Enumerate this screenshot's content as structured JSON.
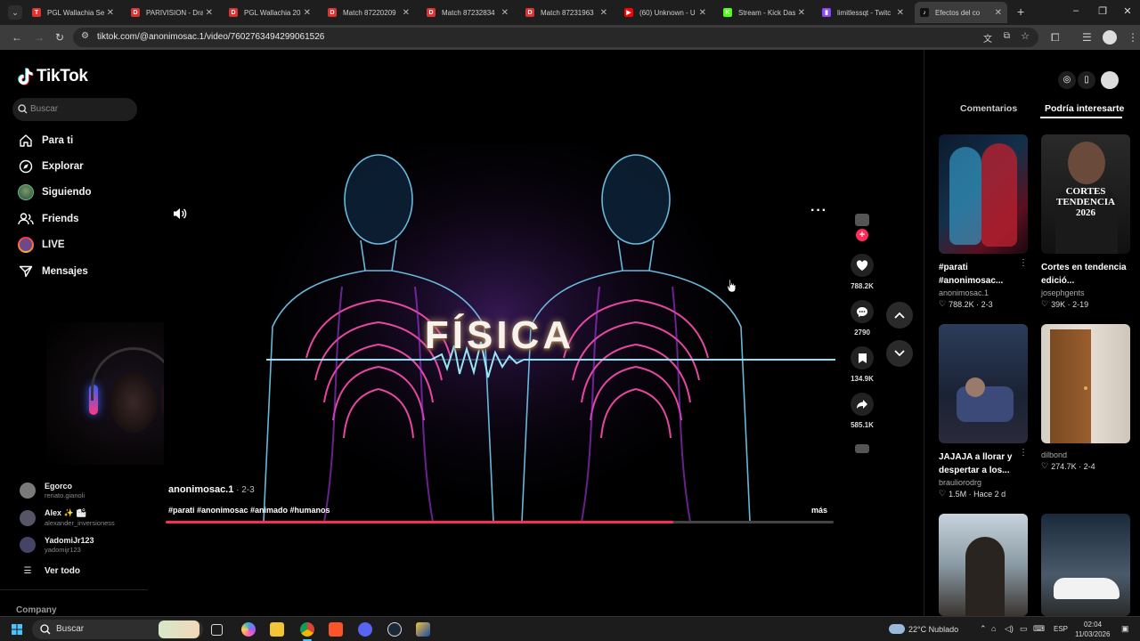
{
  "browser": {
    "tabs": [
      {
        "title": "PGL Wallachia Se",
        "color": "#d33",
        "glyph": "T"
      },
      {
        "title": "PARIVISION - Dra",
        "color": "#d33",
        "glyph": "D"
      },
      {
        "title": "PGL Wallachia 20",
        "color": "#d33",
        "glyph": "D"
      },
      {
        "title": "Match 87220209",
        "color": "#d33",
        "glyph": "D"
      },
      {
        "title": "Match 87232834",
        "color": "#d33",
        "glyph": "D"
      },
      {
        "title": "Match 87231963",
        "color": "#d33",
        "glyph": "D"
      },
      {
        "title": "(60) Unknown - U",
        "color": "#ff0000",
        "glyph": "▶"
      },
      {
        "title": "Stream - Kick Das",
        "color": "#53fc18",
        "glyph": "K"
      },
      {
        "title": "limitlessqt - Twitc",
        "color": "#9146ff",
        "glyph": "▮"
      },
      {
        "title": "Efectos del co",
        "color": "#111",
        "glyph": "♪"
      }
    ],
    "url": "tiktok.com/@anonimosac.1/video/7602763494299061526"
  },
  "tiktok": {
    "logo": "TikTok",
    "search_placeholder": "Buscar",
    "nav": [
      {
        "label": "Para ti",
        "icon": "home-icon"
      },
      {
        "label": "Explorar",
        "icon": "compass-icon"
      },
      {
        "label": "Siguiendo",
        "icon": "following-avatar-icon"
      },
      {
        "label": "Friends",
        "icon": "friends-icon"
      },
      {
        "label": "LIVE",
        "icon": "live-icon"
      },
      {
        "label": "Mensajes",
        "icon": "messages-icon"
      }
    ],
    "following": [
      {
        "name": "Egorco",
        "handle": "renato.gianoli"
      },
      {
        "name": "Alex ✨ 🏙",
        "handle": "alexander_inversioness"
      },
      {
        "name": "YadomiJr123",
        "handle": "yadomijr123"
      }
    ],
    "see_all": "Ver todo",
    "company": "Company"
  },
  "video": {
    "overlay_title": "FÍSICA",
    "author": "anonimosac.1",
    "date": " · 2-3",
    "tags": "#parati #anonimosac #animado #humanos",
    "more": "más",
    "progress": 0.76,
    "likes": "788.2K",
    "comments": "2790",
    "saves": "134.9K",
    "shares": "585.1K"
  },
  "right_panel": {
    "tabs": [
      "Comentarios",
      "Podría interesarte"
    ],
    "cards": [
      {
        "title": "#parati #anonimosac...",
        "author": "anonimosac.1",
        "likes": "788.2K",
        "date": "2-3",
        "thumb_label": ""
      },
      {
        "title": "Cortes en tendencia edició...",
        "author": "josephgents",
        "likes": "39K",
        "date": "2-19",
        "thumb_label": "CORTES TENDENCIA 2026"
      },
      {
        "title": "JAJAJA a llorar y despertar a los...",
        "author": "brauliorodrg",
        "likes": "1.5M",
        "date": "Hace 2 d",
        "thumb_label": ""
      },
      {
        "title": "",
        "author": "dilbond",
        "likes": "274.7K",
        "date": "2-4",
        "thumb_label": ""
      }
    ]
  },
  "taskbar": {
    "search": "Buscar",
    "weather": "22°C  Nublado",
    "lang": "ESP",
    "time": "02:04",
    "date": "11/03/2026"
  }
}
